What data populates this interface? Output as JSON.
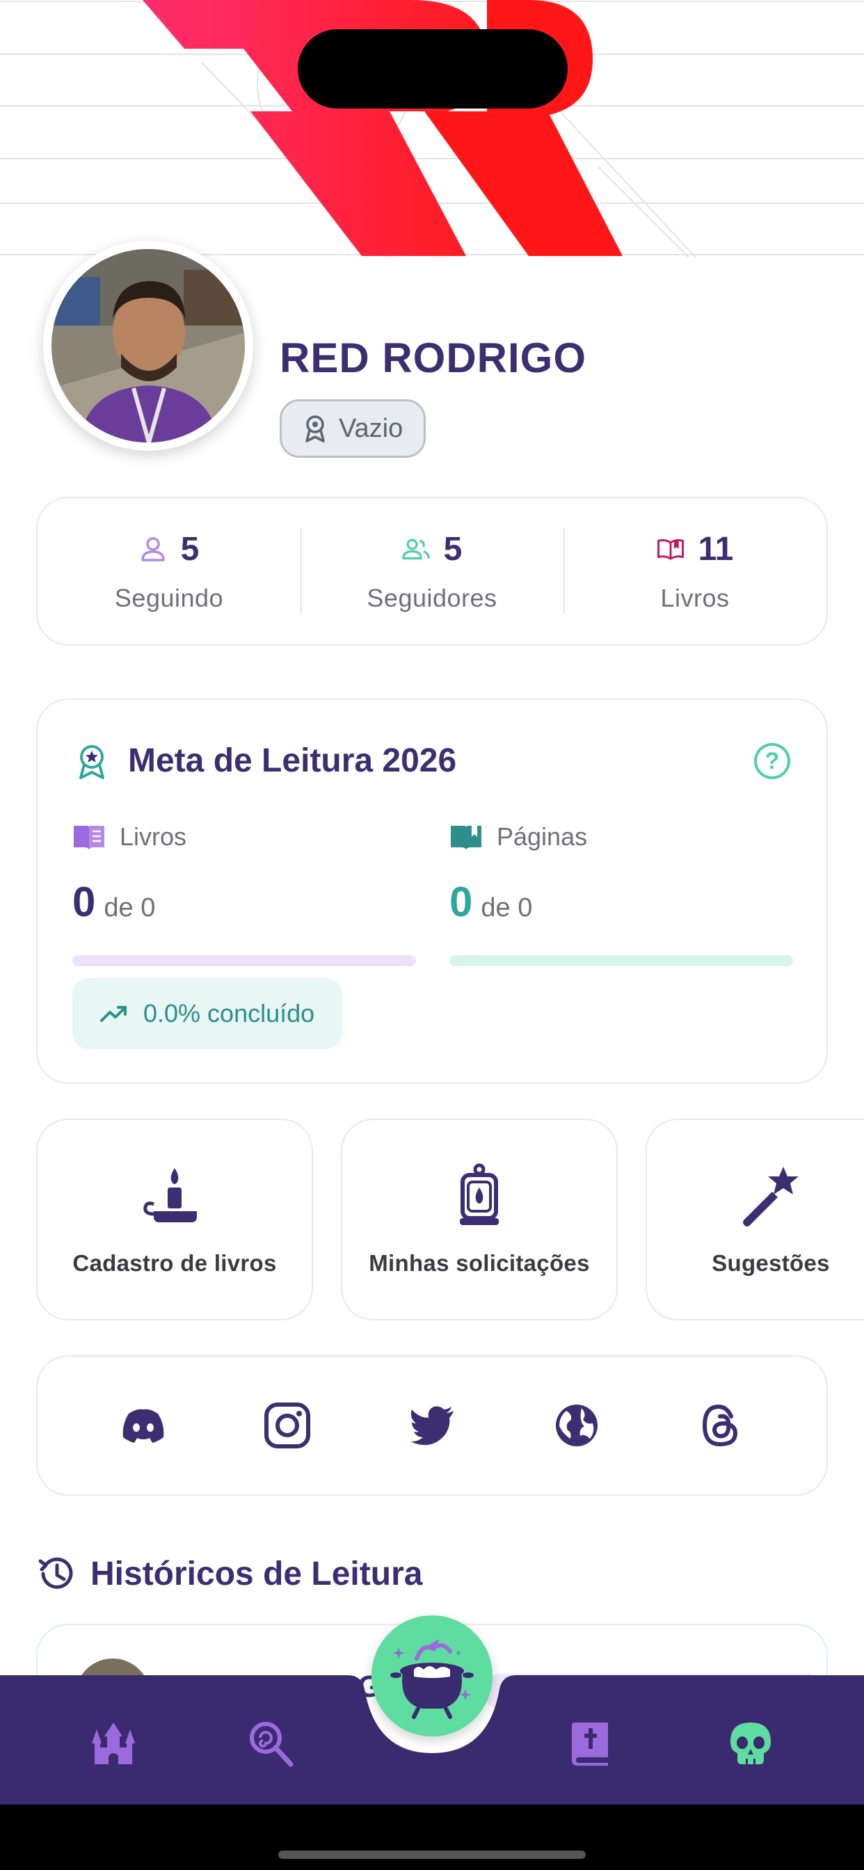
{
  "profile": {
    "name": "RED RODRIGO",
    "badge_label": "Vazio"
  },
  "stats": [
    {
      "value": "5",
      "label": "Seguindo",
      "icon": "user-icon"
    },
    {
      "value": "5",
      "label": "Seguidores",
      "icon": "users-icon"
    },
    {
      "value": "11",
      "label": "Livros",
      "icon": "open-book-icon"
    }
  ],
  "reading_goal": {
    "title": "Meta de Leitura 2026",
    "help_icon": "question-circle-icon",
    "books": {
      "label": "Livros",
      "count": "0",
      "of_text": "de 0",
      "progress": 0
    },
    "pages": {
      "label": "Páginas",
      "count": "0",
      "of_text": "de 0",
      "progress": 0
    },
    "completion_text": "0.0% concluído"
  },
  "shortcuts": [
    {
      "label": "Cadastro de livros",
      "icon": "candle-icon"
    },
    {
      "label": "Minhas solicitações",
      "icon": "lantern-icon"
    },
    {
      "label": "Sugestões",
      "icon": "magic-wand-icon"
    }
  ],
  "socials": [
    "discord-icon",
    "instagram-icon",
    "twitter-icon",
    "globe-icon",
    "threads-icon"
  ],
  "history": {
    "title": "Históricos de Leitura",
    "first_entry_name": "RED RODRIGO"
  },
  "bottom_nav": {
    "items": [
      "castle-icon",
      "lollipop-search-icon",
      "cauldron-icon",
      "book-cross-icon",
      "skull-icon"
    ],
    "active": "cauldron-icon"
  },
  "colors": {
    "primary": "#3b2f72",
    "teal": "#4fd0a8",
    "purple_accent": "#9b6bde",
    "brand_red": "#ff1f3d",
    "nav_bg": "#3a2b70"
  }
}
